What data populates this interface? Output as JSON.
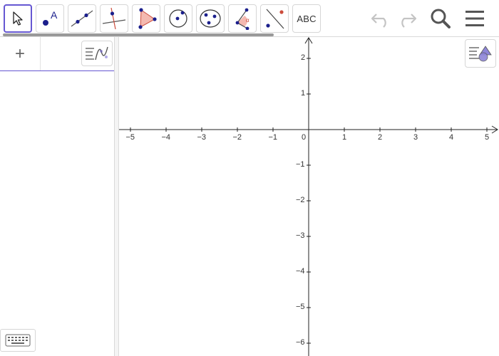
{
  "toolbar": {
    "tools": [
      {
        "name": "move-tool",
        "icon": "move-arrow-icon",
        "active": true
      },
      {
        "name": "point-tool",
        "icon": "point-with-label-icon",
        "label": "A"
      },
      {
        "name": "line-tool",
        "icon": "line-through-points-icon"
      },
      {
        "name": "perpendicular-line-tool",
        "icon": "perpendicular-line-icon"
      },
      {
        "name": "polygon-tool",
        "icon": "polygon-icon"
      },
      {
        "name": "circle-tool",
        "icon": "circle-center-point-icon"
      },
      {
        "name": "conic-tool",
        "icon": "ellipse-icon"
      },
      {
        "name": "angle-tool",
        "icon": "angle-icon",
        "angle_label": "α"
      },
      {
        "name": "reflect-tool",
        "icon": "reflect-about-line-icon"
      },
      {
        "name": "text-tool",
        "icon": "text-icon",
        "label": "ABC"
      }
    ],
    "undo_icon": "undo-icon",
    "redo_icon": "redo-icon",
    "search_icon": "search-icon",
    "menu_icon": "hamburger-menu-icon"
  },
  "algebra": {
    "add_label": "+",
    "style_icon": "algebra-style-icon",
    "keyboard_icon": "keyboard-icon"
  },
  "graphics": {
    "style_icon": "graphics-style-icon",
    "axes": {
      "x_ticks": [
        "−5",
        "−4",
        "−3",
        "−2",
        "−1",
        "0",
        "1",
        "2",
        "3",
        "4",
        "5"
      ],
      "y_ticks_positive": [
        "2",
        "1"
      ],
      "y_ticks_negative": [
        "−1",
        "−2",
        "−3",
        "−4",
        "−5",
        "−6"
      ]
    }
  },
  "colors": {
    "accent": "#6557d2",
    "point": "#1b1f8c",
    "polygon_fill": "#f4b9b0",
    "polygon_stroke": "#cc4c3c"
  }
}
